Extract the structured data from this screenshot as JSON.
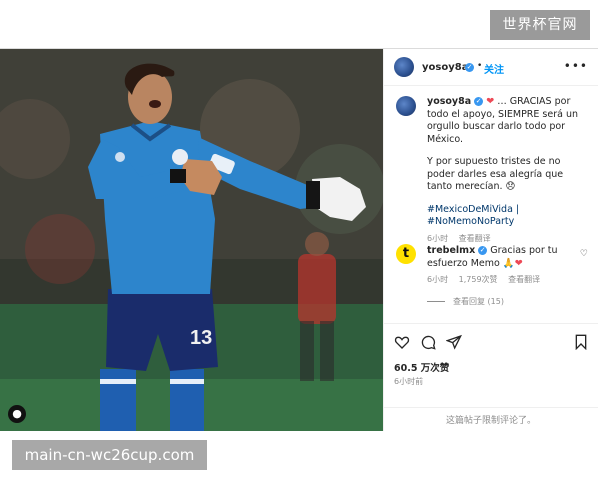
{
  "watermark_top": "世界杯官网",
  "watermark_bottom": "main-cn-wc26cup.com",
  "post": {
    "username": "yosoy8a",
    "follow_label": "关注",
    "more_icon": "more-horizontal-icon",
    "photo": {
      "jersey_number": "13"
    },
    "caption": {
      "part1": "… GRACIAS por todo el apoyo, SIEMPRE será un orgullo buscar darlo todo por México.",
      "part2": "Y por supuesto tristes de no poder darles esa alegría que tanto merecían.",
      "hashtag1": "#MexicoDeMiVida |",
      "hashtag2": "#NoMemoNoParty",
      "time": "6小时",
      "translate": "查看翻译"
    },
    "comment": {
      "username": "trebelmx",
      "avatar_letter": "t",
      "text": "Gracias por tu esfuerzo Memo",
      "time": "6小时",
      "likes": "1,759次赞",
      "translate": "查看翻译",
      "view_replies": "查看回复 (15)"
    },
    "likes_count": "60.5 万次赞",
    "post_time": "6小时前",
    "comments_disabled": "这篇帖子限制评论了。"
  },
  "colors": {
    "link_blue": "#0095f6",
    "hashtag": "#00376b",
    "heart": "#ed4956",
    "verified": "#3897f0"
  }
}
